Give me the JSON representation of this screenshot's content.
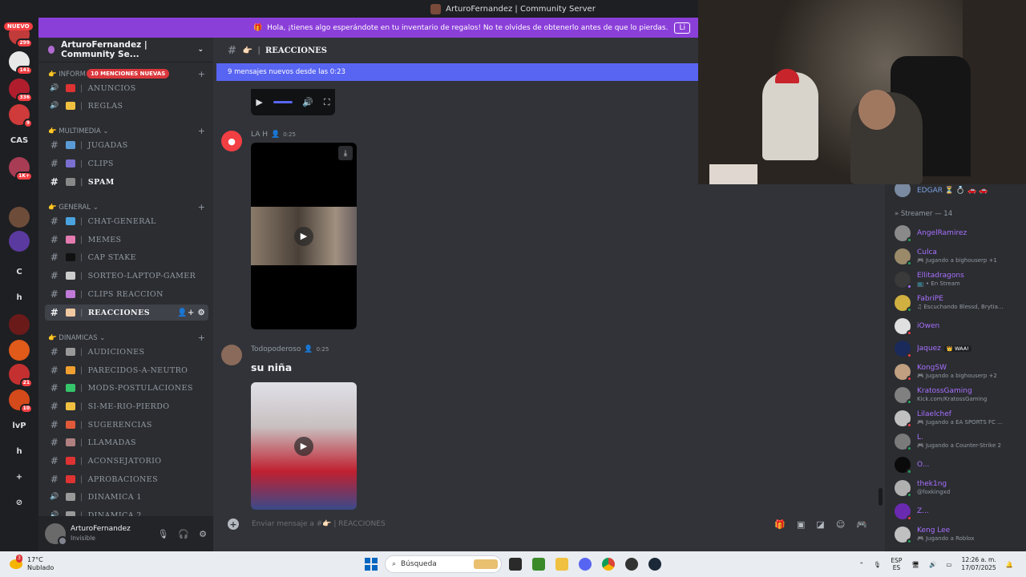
{
  "window": {
    "title": "ArturoFernandez | Community Server"
  },
  "notice": {
    "text": "Hola, ¡tienes algo esperándote en tu inventario de regalos! No te olvides de obtenerlo antes de que lo pierdas.",
    "button": "Li"
  },
  "rail": {
    "nuevo": "NUEVO",
    "servers": [
      {
        "label": "",
        "badge": "299",
        "color": "#c23b3b"
      },
      {
        "label": "",
        "badge": "141",
        "color": "#e8e8e8"
      },
      {
        "label": "",
        "badge": "336",
        "color": "#b01e2e"
      },
      {
        "label": "",
        "badge": "9",
        "color": "#cf3a3a"
      },
      {
        "label": "CAS",
        "badge": "",
        "color": "#1e1f22"
      },
      {
        "label": "",
        "badge": "1K+",
        "color": "#a83c54"
      },
      {
        "label": "",
        "badge": "",
        "color": "#1e1f22"
      },
      {
        "label": "",
        "badge": "",
        "color": "#6d4d3a"
      },
      {
        "label": "",
        "badge": "",
        "color": "#5b3aa0"
      },
      {
        "label": "C",
        "badge": "",
        "color": "#1e1f22"
      },
      {
        "label": "h",
        "badge": "",
        "color": "#1e1f22"
      },
      {
        "label": "",
        "badge": "",
        "color": "#6b1a1a"
      },
      {
        "label": "",
        "badge": "",
        "color": "#e05a1a"
      },
      {
        "label": "",
        "badge": "21",
        "color": "#c43030"
      },
      {
        "label": "",
        "badge": "10",
        "color": "#d44a1a"
      },
      {
        "label": "lvP",
        "badge": "",
        "color": "#1e1f22"
      },
      {
        "label": "h",
        "badge": "",
        "color": "#1e1f22"
      },
      {
        "label": "+",
        "badge": "",
        "color": "#1e1f22"
      },
      {
        "label": "⊘",
        "badge": "",
        "color": "#1e1f22"
      }
    ]
  },
  "sidebar": {
    "server_name": "ArturoFernandez | Community Se...",
    "mentions": "10 MENCIONES NUEVAS",
    "categories": [
      {
        "label": "👉 INFORM",
        "top": 0
      },
      {
        "label": "👉 MULTIMEDIA ⌄"
      },
      {
        "label": "👉 GENERAL ⌄"
      },
      {
        "label": "👉 DINAMICAS ⌄"
      }
    ],
    "channels": [
      {
        "name": "ANUNCIOS",
        "color": "#d33"
      },
      {
        "name": "REGLAS",
        "color": "#f0c040"
      },
      {
        "name": "JUGADAS",
        "color": "#5b9bd5"
      },
      {
        "name": "CLIPS",
        "color": "#7a6fd0"
      },
      {
        "name": "SPAM",
        "color": "#888"
      },
      {
        "name": "CHAT-GENERAL",
        "color": "#4aa3df"
      },
      {
        "name": "MEMES",
        "color": "#e37ab0"
      },
      {
        "name": "CAP  STAKE",
        "color": "#111"
      },
      {
        "name": "SORTEO-LAPTOP-GAMER",
        "color": "#ccc"
      },
      {
        "name": "CLIPS  REACCION",
        "color": "#c07ad8"
      },
      {
        "name": "REACCIONES",
        "color": "#f0c9a0"
      },
      {
        "name": "AUDICIONES",
        "color": "#999"
      },
      {
        "name": "PARECIDOS-A-NEUTRO",
        "color": "#f0a030"
      },
      {
        "name": "MODS-POSTULACIONES",
        "color": "#35c46a"
      },
      {
        "name": "SI-ME-RIO-PIERDO",
        "color": "#f0c040"
      },
      {
        "name": "SUGERENCIAS",
        "color": "#e05a3a"
      },
      {
        "name": "LLAMADAS",
        "color": "#b08080"
      },
      {
        "name": "ACONSEJATORIO",
        "color": "#d33"
      },
      {
        "name": "APROBACIONES",
        "color": "#d33"
      },
      {
        "name": "DINAMICA 1",
        "color": "#999"
      },
      {
        "name": "DINAMICA 2",
        "color": "#999"
      }
    ]
  },
  "user": {
    "name": "ArturoFernandez",
    "status": "Invisible"
  },
  "chat": {
    "channel": "REACCIONES",
    "new_messages": "9 mensajes nuevos desde las 0:23",
    "messages": [
      {
        "author": "LA H",
        "time": "0:25"
      },
      {
        "author": "Todopoderoso",
        "time": "0:25",
        "text": "su niña"
      }
    ],
    "composer_placeholder": "Enviar mensaje a #👉🏻 | REACCIONES"
  },
  "members": {
    "top": {
      "name": "EDGAR ⏳ 💍 🚗 🚗"
    },
    "category": "» Streamer — 14",
    "list": [
      {
        "name": "AngelRamirez",
        "activity": "",
        "color": "#8a8a8a",
        "status": "#23a55a"
      },
      {
        "name": "Culca",
        "activity": "🎮 Jugando a bighouserp +1",
        "color": "#9a8a6a",
        "status": "#23a55a"
      },
      {
        "name": "Ellitadragons",
        "activity": "📺 • En Stream",
        "color": "#3a3a3a",
        "status": "#a970ff"
      },
      {
        "name": "FabriPE",
        "activity": "♫ Escuchando Blessd, Brytia...",
        "color": "#d0b040",
        "status": "#23a55a"
      },
      {
        "name": "iOwen",
        "activity": "",
        "color": "#e0e0e0",
        "status": "#f23f43"
      },
      {
        "name": "Jaquez",
        "activity": "",
        "tag": "👑 WAA!",
        "color": "#1a2a5a",
        "status": "#f23f43"
      },
      {
        "name": "KongSW",
        "activity": "🎮 Jugando a bighouserp +2",
        "color": "#c0a080",
        "status": "#f23f43"
      },
      {
        "name": "KratossGaming",
        "activity": "Kick.com/KratossGaming",
        "color": "#808080",
        "status": "#23a55a"
      },
      {
        "name": "Lilaelchef",
        "activity": "🎮 Jugando a EA SPORTS FC ...",
        "color": "#c0c0c0",
        "status": "#f23f43"
      },
      {
        "name": "L.",
        "activity": "🎮 Jugando a Counter-Strike 2",
        "color": "#7a7a7a",
        "status": "#23a55a"
      },
      {
        "name": "O...",
        "activity": "",
        "color": "#0a0a0a",
        "status": "#23a55a"
      },
      {
        "name": "thek1ng",
        "activity": "@foxkingxd",
        "color": "#b0b0b0",
        "status": "#23a55a"
      },
      {
        "name": "Z...",
        "activity": "",
        "color": "#6a2ab0",
        "status": "#f23f43"
      },
      {
        "name": "Keng Lee",
        "activity": "🎮 Jugando a Roblox",
        "color": "#c0c0c0",
        "status": "#23a55a"
      }
    ]
  },
  "taskbar": {
    "weather_temp": "17°C",
    "weather_desc": "Nublado",
    "weather_badge": "3",
    "search": "Búsqueda",
    "lang": "ESP",
    "lang2": "ES",
    "time": "12:26 a. m.",
    "date": "17/07/2025"
  }
}
